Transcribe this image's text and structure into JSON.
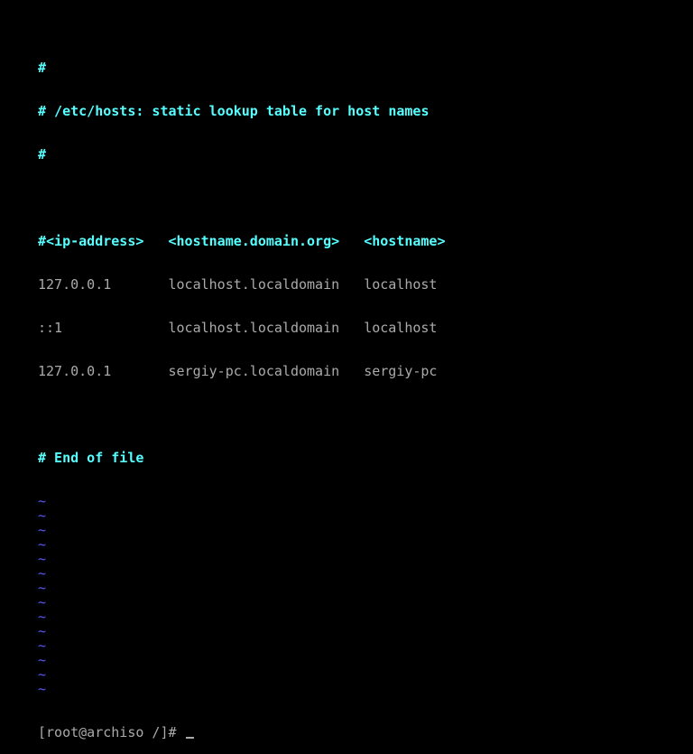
{
  "file": {
    "header_comments": [
      "#",
      "# /etc/hosts: static lookup table for host names",
      "#"
    ],
    "table_header": [
      "#<ip-address>",
      "<hostname.domain.org>",
      "<hostname>"
    ],
    "rows": [
      [
        "127.0.0.1",
        "localhost.localdomain",
        "localhost"
      ],
      [
        "::1",
        "localhost.localdomain",
        "localhost"
      ],
      [
        "127.0.0.1",
        "sergiy-pc.localdomain",
        "sergiy-pc"
      ]
    ],
    "end_comment": "# End of file",
    "empty_line_marker": "~"
  },
  "prompt": {
    "text": "[root@archiso /]# "
  },
  "colors": {
    "comment": "#55ffff",
    "text": "#aaaaaa",
    "tilde": "#5555ff",
    "background": "#000000"
  }
}
